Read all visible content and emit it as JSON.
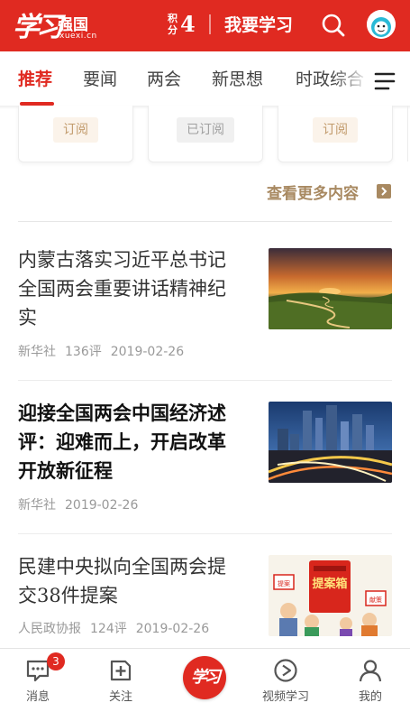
{
  "header": {
    "logo_script": "学习",
    "logo_brand": "强国",
    "logo_domain": "xuexi.cn",
    "points_label": "积分",
    "points_value": "4",
    "study_button": "我要学习",
    "search_icon": "search-icon",
    "avatar_text": "S",
    "brand_color": "#e02a21"
  },
  "tabs": {
    "items": [
      "推荐",
      "要闻",
      "两会",
      "新思想",
      "时政综合"
    ],
    "active": "推荐",
    "menu_icon": "hamburger-menu-icon"
  },
  "subscriptions": {
    "cards": [
      {
        "button": "订阅",
        "state": "unsubscribed"
      },
      {
        "button": "已订阅",
        "state": "subscribed"
      },
      {
        "button": "订阅",
        "state": "unsubscribed"
      }
    ],
    "more_link": "查看更多内容"
  },
  "articles": [
    {
      "title": "内蒙古落实习近平总书记全国两会重要讲话精神纪实",
      "source": "新华社",
      "comments": "136评",
      "date": "2019-02-26",
      "image": "grassland-sunset"
    },
    {
      "title": "迎接全国两会中国经济述评：迎难而上，开启改革开放新征程",
      "source": "新华社",
      "comments": "",
      "date": "2019-02-26",
      "image": "city-skyline-night"
    },
    {
      "title": "民建中央拟向全国两会提交38件提案",
      "source": "人民政协报",
      "comments": "124评",
      "date": "2019-02-26",
      "image": "proposal-box-cartoon",
      "thumb_text": {
        "box_label": "提案箱",
        "sign_left": "提案",
        "sign_right": "献策"
      }
    }
  ],
  "bottom_nav": {
    "items": [
      {
        "label": "消息",
        "icon": "message-icon",
        "badge": "3"
      },
      {
        "label": "关注",
        "icon": "follow-plus-icon"
      },
      {
        "label": "学习",
        "icon": "study-center-logo",
        "center": true
      },
      {
        "label": "视频学习",
        "icon": "video-play-icon"
      },
      {
        "label": "我的",
        "icon": "profile-icon"
      }
    ]
  }
}
